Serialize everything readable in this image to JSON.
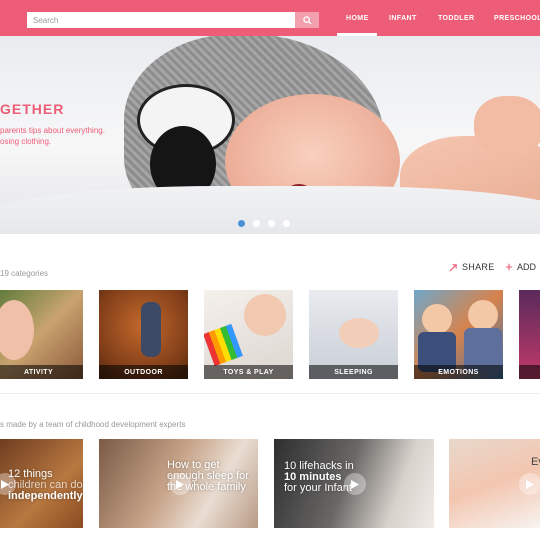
{
  "header": {
    "search_placeholder": "Search",
    "nav": [
      "HOME",
      "INFANT",
      "TODDLER",
      "PRESCHOOL"
    ],
    "active_nav": "HOME",
    "brand_color": "#ed5d77"
  },
  "hero": {
    "title": "GETHER",
    "subtitle_line1": "parents tips about everything.",
    "subtitle_line2": "osing clothing.",
    "slide_count": 4,
    "active_slide": 1
  },
  "categories": {
    "count_text": "19 categories",
    "share_label": "SHARE",
    "add_label": "ADD",
    "items": [
      {
        "label": "ATIVITY"
      },
      {
        "label": "OUTDOOR"
      },
      {
        "label": "TOYS & PLAY"
      },
      {
        "label": "SLEEPING"
      },
      {
        "label": "EMOTIONS"
      },
      {
        "label": ""
      }
    ]
  },
  "videos": {
    "intro_text": "s made by a team of childhood development experts",
    "items": [
      {
        "title_lines": [
          "12 things",
          "children can do",
          "independently"
        ]
      },
      {
        "title_lines": [
          "How to get",
          "enough sleep for",
          "the whole family"
        ]
      },
      {
        "title_lines": [
          "10 lifehacks in",
          "10 minutes",
          "for your Infant"
        ]
      },
      {
        "title_lines": [
          "Ev",
          "",
          ""
        ]
      }
    ]
  }
}
